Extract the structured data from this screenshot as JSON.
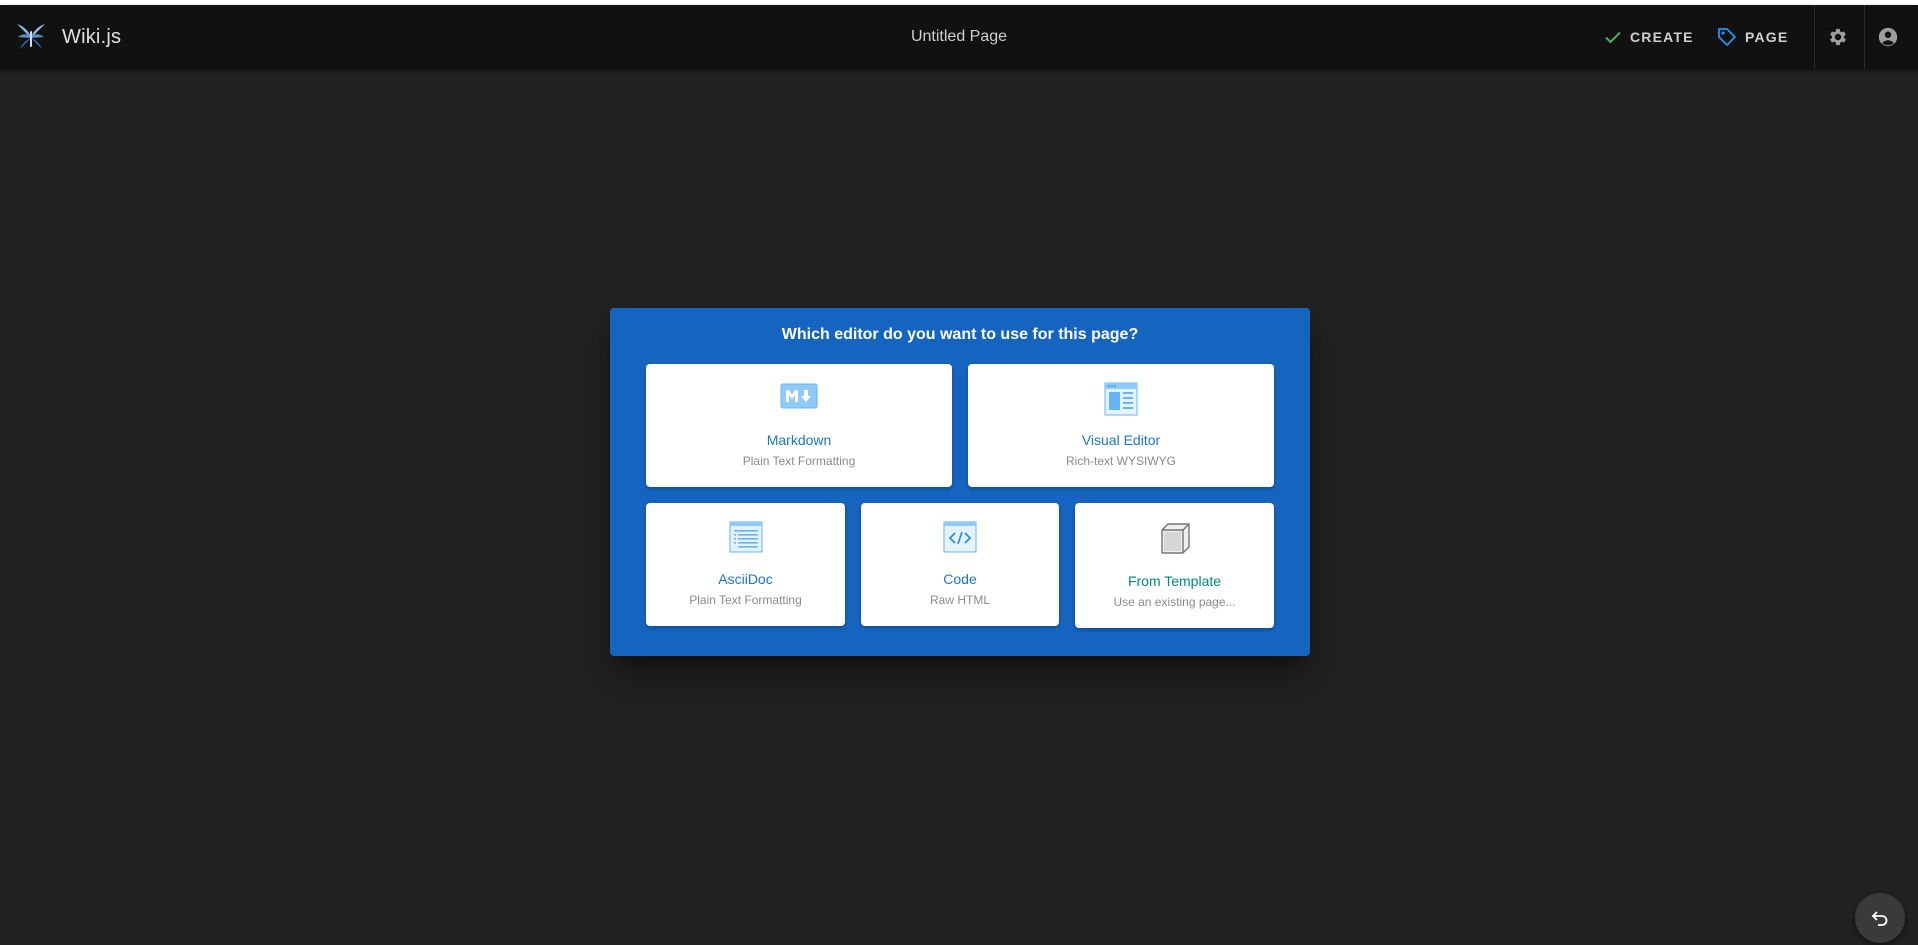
{
  "app": {
    "brand": "Wiki.js",
    "page_title": "Untitled Page"
  },
  "toolbar": {
    "create_label": "CREATE",
    "page_label": "PAGE"
  },
  "dialog": {
    "title": "Which editor do you want to use for this page?",
    "editors": [
      {
        "title": "Markdown",
        "subtitle": "Plain Text Formatting",
        "icon": "markdown-icon"
      },
      {
        "title": "Visual Editor",
        "subtitle": "Rich-text WYSIWYG",
        "icon": "visual-editor-icon"
      },
      {
        "title": "AsciiDoc",
        "subtitle": "Plain Text Formatting",
        "icon": "asciidoc-icon"
      },
      {
        "title": "Code",
        "subtitle": "Raw HTML",
        "icon": "code-icon"
      },
      {
        "title": "From Template",
        "subtitle": "Use an existing page...",
        "icon": "template-cube-icon"
      }
    ]
  },
  "colors": {
    "background": "#222222",
    "topbar": "#111111",
    "dialog": "#1565c0",
    "accent_blue": "#1976d2",
    "template_teal": "#00897b",
    "create_check": "#4caf50",
    "page_tag": "#2196f3"
  }
}
